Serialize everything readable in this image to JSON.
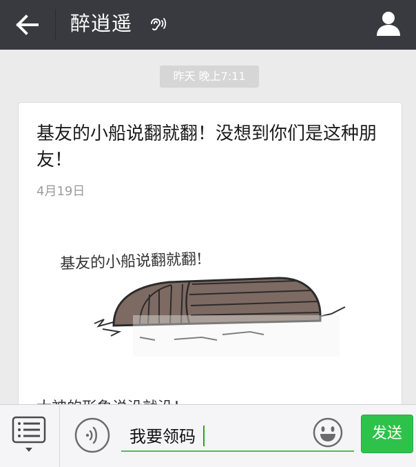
{
  "header": {
    "title": "醉逍遥",
    "back_icon": "arrow-left-icon",
    "ear_icon": "ear-icon",
    "profile_icon": "person-icon"
  },
  "timestamp": "昨天 晚上7:11",
  "article": {
    "title": "基友的小船说翻就翻！没想到你们是这种朋友！",
    "date": "4月19日",
    "image_caption": "基友的小船说翻就翻!",
    "summary": "大神的形象说没就没！"
  },
  "input_bar": {
    "menu_icon": "list-menu-icon",
    "voice_icon": "voice-icon",
    "text_value": "我要领码",
    "emoji_icon": "smiley-icon",
    "send_label": "发送"
  },
  "colors": {
    "topbar": "#393a3f",
    "send_button": "#2fc24a",
    "input_underline": "#4cc041",
    "background": "#ebebeb"
  }
}
